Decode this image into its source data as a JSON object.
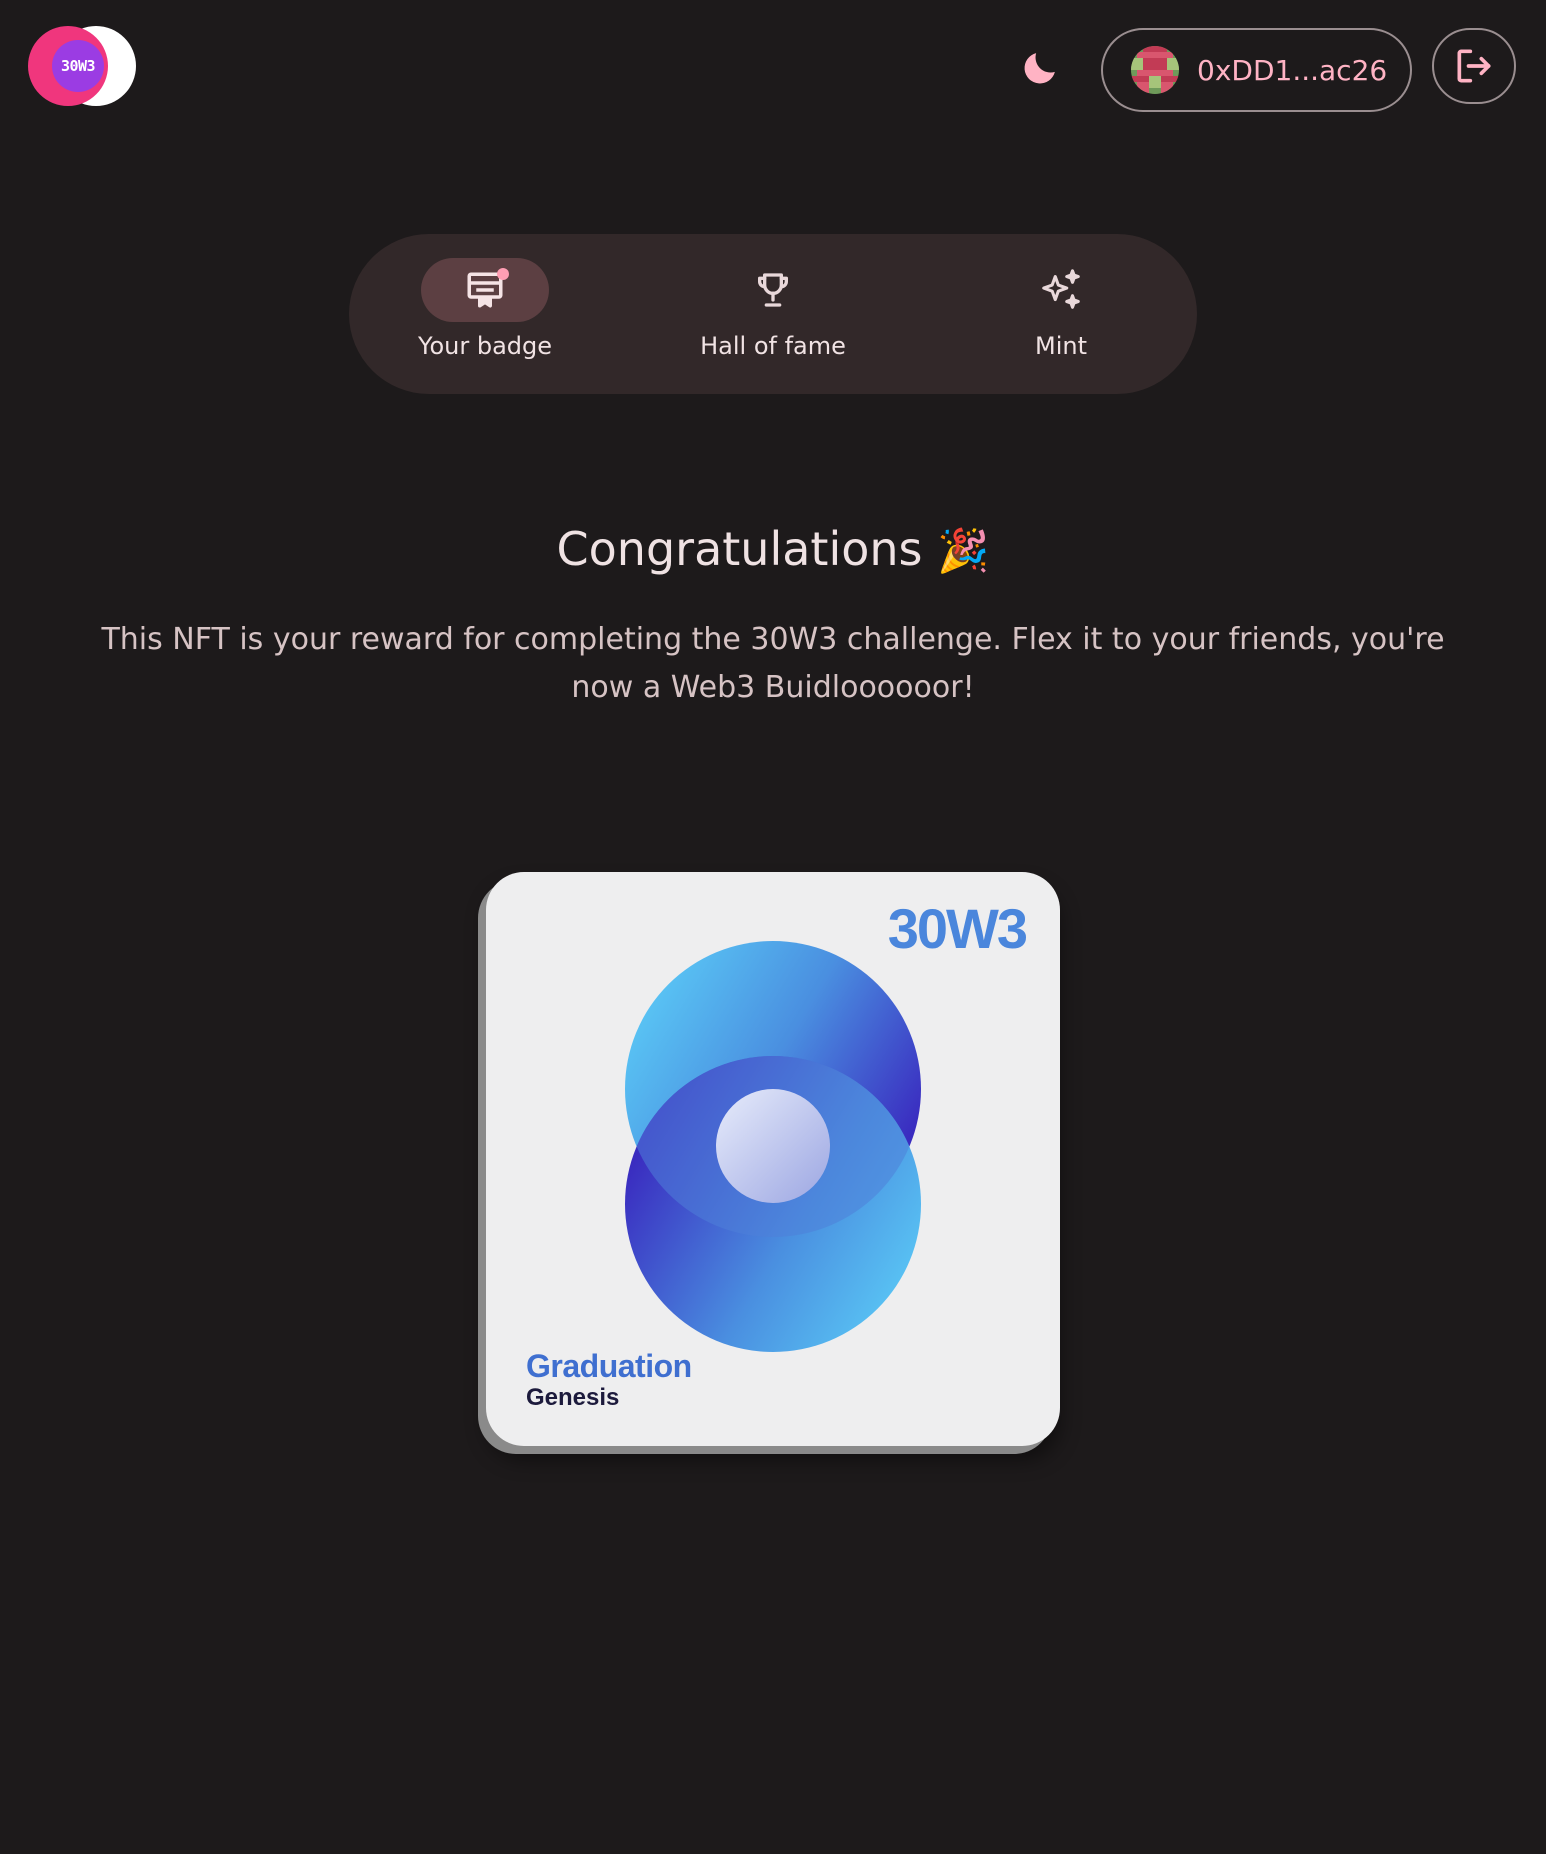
{
  "header": {
    "logo_text": "30W3",
    "wallet_address": "0xDD1...ac26"
  },
  "nav": {
    "items": [
      {
        "label": "Your badge",
        "icon": "badge-icon",
        "active": true
      },
      {
        "label": "Hall of fame",
        "icon": "trophy-icon",
        "active": false
      },
      {
        "label": "Mint",
        "icon": "sparkles-icon",
        "active": false
      }
    ]
  },
  "main": {
    "title": "Congratulations",
    "title_emoji": "🎉",
    "description": "This NFT is your reward for completing the 30W3 challenge. Flex it to your friends, you're now a Web3 Buidloooooor!"
  },
  "nft": {
    "brand": "30W3",
    "line1": "Graduation",
    "line2": "Genesis"
  },
  "colors": {
    "background": "#1d1a1b",
    "accent_pink": "#ffb3c4",
    "nav_bg": "#322829",
    "nav_active": "#5c3f42",
    "brand_blue": "#4a86dc"
  }
}
